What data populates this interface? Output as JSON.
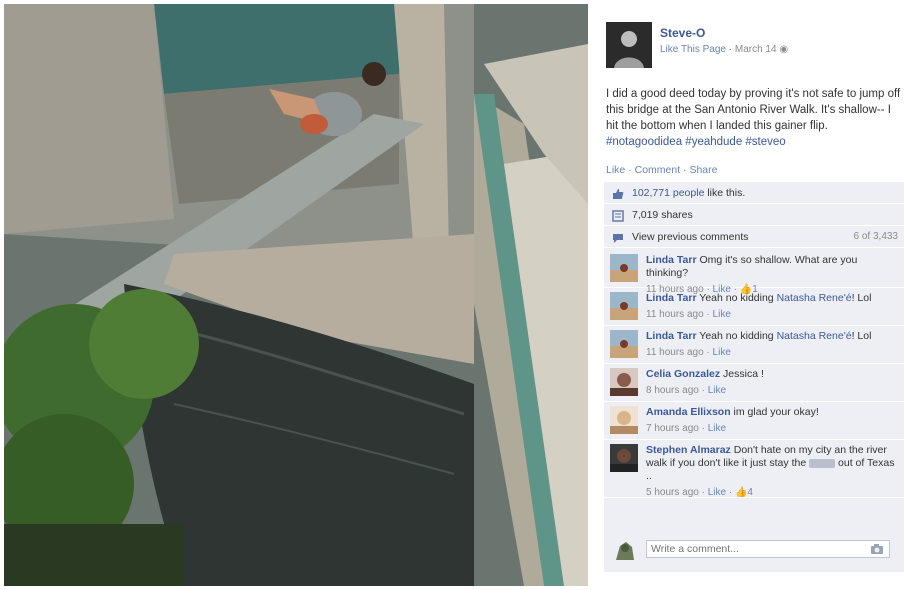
{
  "post": {
    "author": "Steve-O",
    "like_page_label": "Like This Page",
    "separator": "·",
    "date": "March 14",
    "text": "I did a good deed today by proving it's not safe to jump off this bridge at the San Antonio River Walk. It's shallow-- I hit the bottom when I landed this gainer flip.",
    "hashtags": "#notagoodidea #yeahdude #steveo"
  },
  "actions": {
    "like": "Like",
    "comment": "Comment",
    "share": "Share",
    "dot": "·"
  },
  "stats": {
    "likes_count": "102,771 people",
    "likes_suffix": "like this.",
    "shares": "7,019 shares",
    "view_previous": "View previous comments",
    "comment_count": "6 of 3,433"
  },
  "comments": [
    {
      "name": "Linda Tarr",
      "text": "Omg it's so shallow. What are you thinking?",
      "time": "11 hours ago",
      "like": "Like",
      "likes": "1",
      "avatar_color": "#c9a47a"
    },
    {
      "name": "Linda Tarr",
      "text_pre": "Yeah no kidding",
      "mention": "Natasha Rene'é",
      "text_post": "! Lol",
      "time": "11 hours ago",
      "like": "Like",
      "avatar_color": "#c9a47a"
    },
    {
      "name": "Linda Tarr",
      "text_pre": "Yeah no kidding",
      "mention": "Natasha Rene'é",
      "text_post": "! Lol",
      "time": "11 hours ago",
      "like": "Like",
      "avatar_color": "#c9a47a"
    },
    {
      "name": "Celia Gonzalez",
      "text": "Jessica !",
      "time": "8 hours ago",
      "like": "Like",
      "avatar_color": "#8a5a4a"
    },
    {
      "name": "Amanda Ellixson",
      "text": "im glad your okay!",
      "time": "7 hours ago",
      "like": "Like",
      "avatar_color": "#d9b48a"
    },
    {
      "name": "Stephen Almaraz",
      "text_pre": "Don't hate on my city an the river walk if you don't like it just stay the",
      "text_post": "out of Texas ..",
      "time": "5 hours ago",
      "like": "Like",
      "likes": "4",
      "avatar_color": "#6a4a3a"
    }
  ],
  "composer": {
    "placeholder": "Write a comment..."
  },
  "colors": {
    "link": "#3b5998",
    "ufi_bg": "#edeff4"
  },
  "icons": {
    "like": "thumbs-up-icon",
    "share": "share-icon",
    "comments": "speech-bubble-icon",
    "camera": "camera-icon",
    "globe": "globe-icon"
  }
}
